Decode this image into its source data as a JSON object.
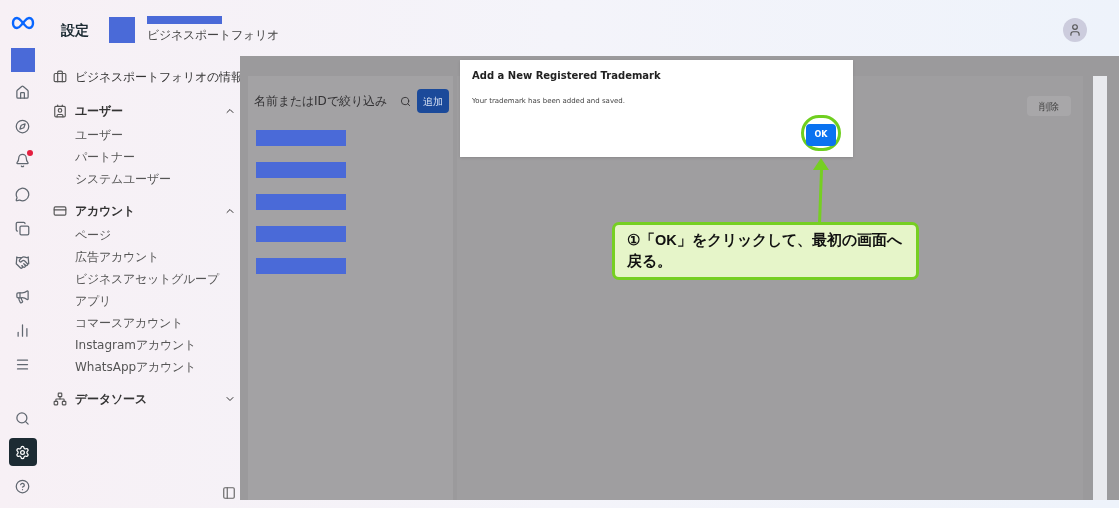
{
  "header": {
    "title": "設定",
    "portfolio_label": "ビジネスポートフォリオ"
  },
  "rail": [
    {
      "kind": "home",
      "selected": false,
      "badge": false
    },
    {
      "kind": "compass",
      "selected": false,
      "badge": false
    },
    {
      "kind": "bell",
      "selected": false,
      "badge": true
    },
    {
      "kind": "chat",
      "selected": false,
      "badge": false
    },
    {
      "kind": "pages",
      "selected": false,
      "badge": false
    },
    {
      "kind": "handshake",
      "selected": false,
      "badge": false
    },
    {
      "kind": "megaphone",
      "selected": false,
      "badge": false
    },
    {
      "kind": "chart",
      "selected": false,
      "badge": false
    },
    {
      "kind": "menu",
      "selected": false,
      "badge": false
    }
  ],
  "rail_bottom": [
    {
      "kind": "search",
      "selected": false
    },
    {
      "kind": "settings",
      "selected": true
    },
    {
      "kind": "help",
      "selected": false
    }
  ],
  "sidebar": {
    "items": [
      {
        "kind": "briefcase",
        "label": "ビジネスポートフォリオの情報"
      },
      {
        "kind": "user",
        "label": "ユーザー",
        "expanded": true,
        "children": [
          {
            "label": "ユーザー"
          },
          {
            "label": "パートナー"
          },
          {
            "label": "システムユーザー"
          }
        ]
      },
      {
        "kind": "account",
        "label": "アカウント",
        "expanded": true,
        "children": [
          {
            "label": "ページ"
          },
          {
            "label": "広告アカウント"
          },
          {
            "label": "ビジネスアセットグループ"
          },
          {
            "label": "アプリ"
          },
          {
            "label": "コマースアカウント"
          },
          {
            "label": "Instagramアカウント"
          },
          {
            "label": "WhatsAppアカウント"
          }
        ]
      },
      {
        "kind": "data",
        "label": "データソース",
        "expanded": false
      }
    ]
  },
  "list": {
    "search": {
      "placeholder": "名前またはIDで絞り込み"
    },
    "add_button": "追加"
  },
  "detail": {
    "delete_button": "削除"
  },
  "dialog": {
    "title": "Add a New Registered Trademark",
    "message": "Your trademark has been added and saved.",
    "ok_button": "OK"
  },
  "callout": {
    "text": "①「OK」をクリックして、最初の画面へ戻る。"
  }
}
